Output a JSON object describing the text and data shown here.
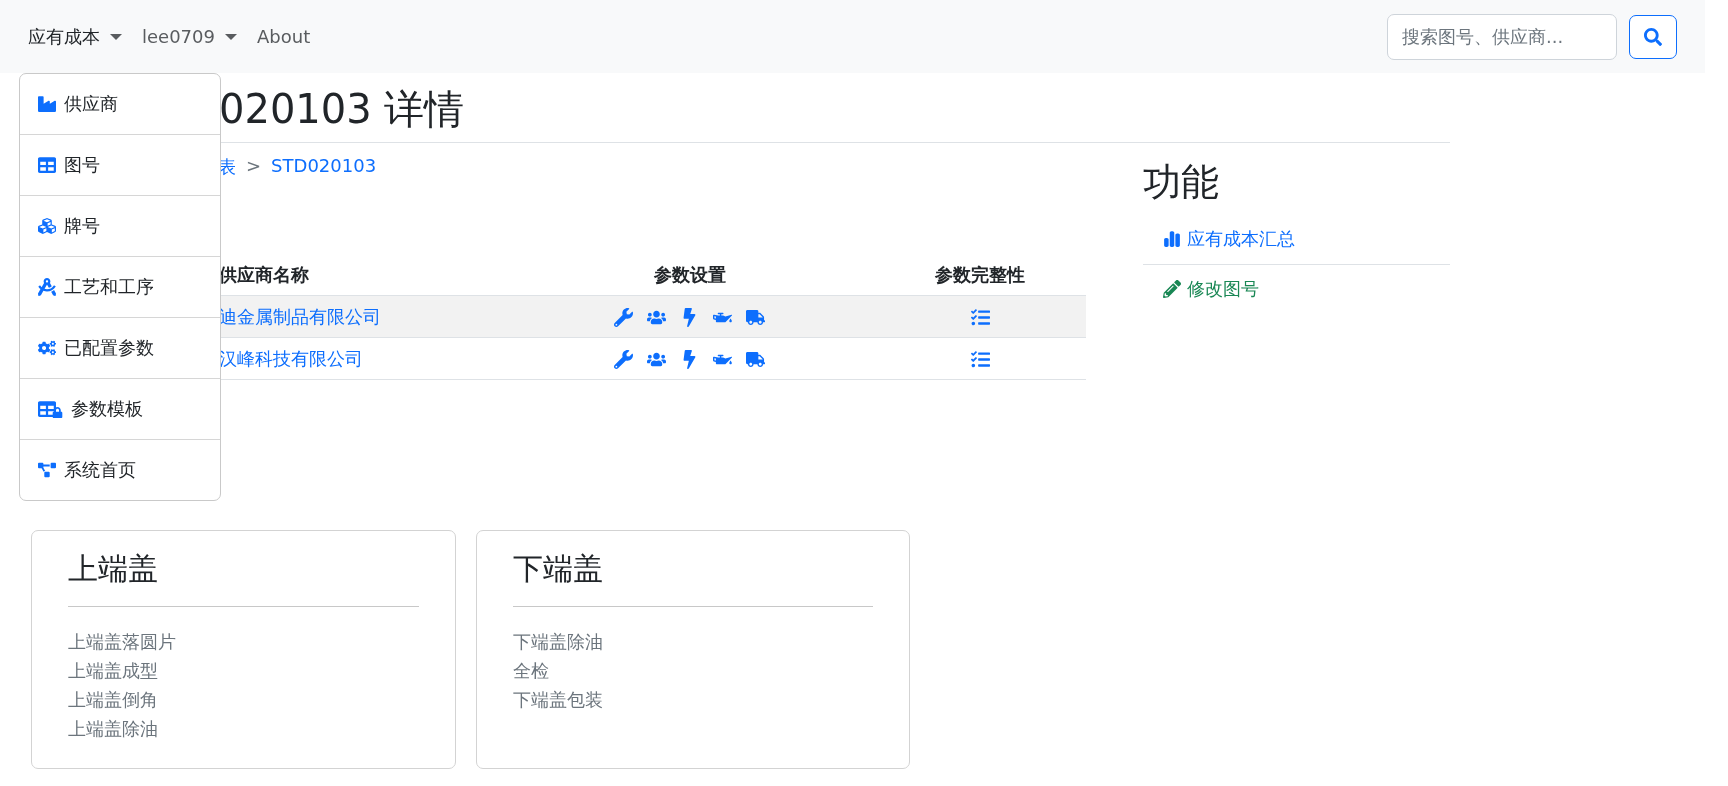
{
  "navbar": {
    "menus": [
      {
        "label": "应有成本",
        "kind": "dropdown",
        "expanded": true
      },
      {
        "label": "lee0709",
        "kind": "dropdown",
        "expanded": false
      },
      {
        "label": "About",
        "kind": "link"
      }
    ],
    "search": {
      "placeholder": "搜索图号、供应商..."
    }
  },
  "dropdown_items": [
    "供应商",
    "图号",
    "牌号",
    "工艺和工序",
    "已配置参数",
    "参数模板",
    "系统首页"
  ],
  "page_title": "020103 详情",
  "breadcrumb": {
    "items": [
      "表",
      "STD020103"
    ],
    "separator": ">"
  },
  "table": {
    "columns": [
      "供应商名称",
      "参数设置",
      "参数完整性"
    ],
    "rows": [
      {
        "supplier": "迪金属制品有限公司"
      },
      {
        "supplier": "汉峰科技有限公司"
      }
    ]
  },
  "functions": {
    "title": "功能",
    "links": [
      {
        "label": "应有成本汇总",
        "kind": "primary"
      },
      {
        "label": "修改图号",
        "kind": "success"
      }
    ]
  },
  "process_cards": [
    {
      "title": "上端盖",
      "steps": [
        "上端盖落圆片",
        "上端盖成型",
        "上端盖倒角",
        "上端盖除油"
      ]
    },
    {
      "title": "下端盖",
      "steps": [
        "下端盖除油",
        "全检",
        "下端盖包装"
      ]
    }
  ]
}
